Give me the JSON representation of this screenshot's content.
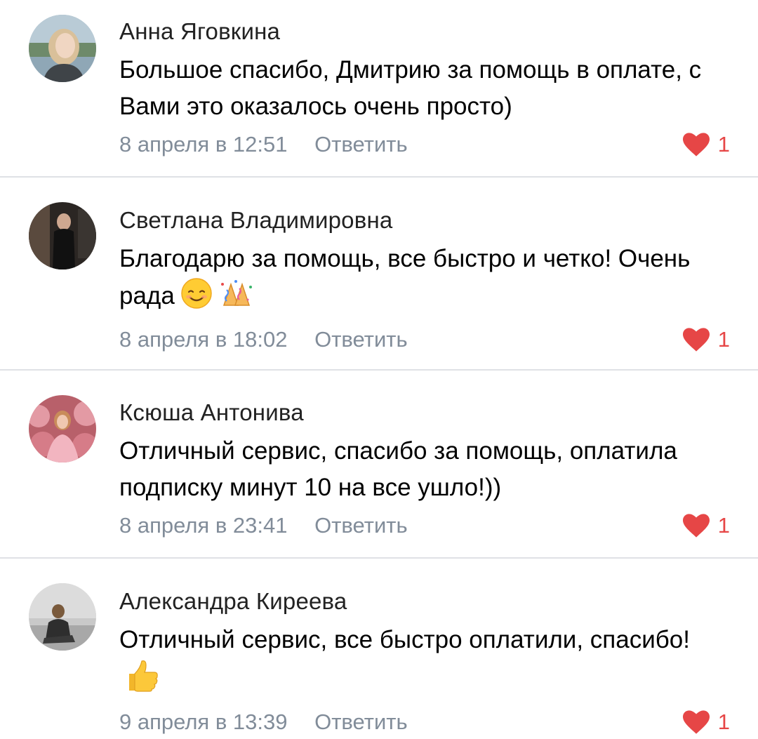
{
  "comments": [
    {
      "author": "Анна Яговкина",
      "text": "Большое спасибо, Дмитрию за помощь в оплате, с Вами это оказалось очень просто)",
      "date": "8 апреля в 12:51",
      "reply_label": "Ответить",
      "likes": "1",
      "avatar_icon": "avatar-photo"
    },
    {
      "author": "Светлана Владимировна",
      "text": "Благодарю за помощь, все быстро и четко! Очень рада",
      "emojis": [
        "smiling-face-emoji",
        "party-popper-emoji"
      ],
      "date": "8 апреля в 18:02",
      "reply_label": "Ответить",
      "likes": "1",
      "avatar_icon": "avatar-photo"
    },
    {
      "author": "Ксюша Антонива",
      "text": "Отличный сервис, спасибо за помощь, оплатила подписку минут 10 на все ушло!))",
      "date": "8 апреля в 23:41",
      "reply_label": "Ответить",
      "likes": "1",
      "avatar_icon": "avatar-photo"
    },
    {
      "author": "Александра Киреева",
      "text": "Отличный сервис, все быстро оплатили, спасибо!",
      "emojis": [
        "thumbs-up-emoji"
      ],
      "date": "9 апреля в 13:39",
      "reply_label": "Ответить",
      "likes": "1",
      "avatar_icon": "avatar-photo"
    }
  ],
  "colors": {
    "meta_text": "#818c99",
    "like_heart": "#e64646",
    "divider": "#dfe1e5",
    "author_text": "#222222"
  },
  "icons": {
    "like": "heart-icon"
  }
}
